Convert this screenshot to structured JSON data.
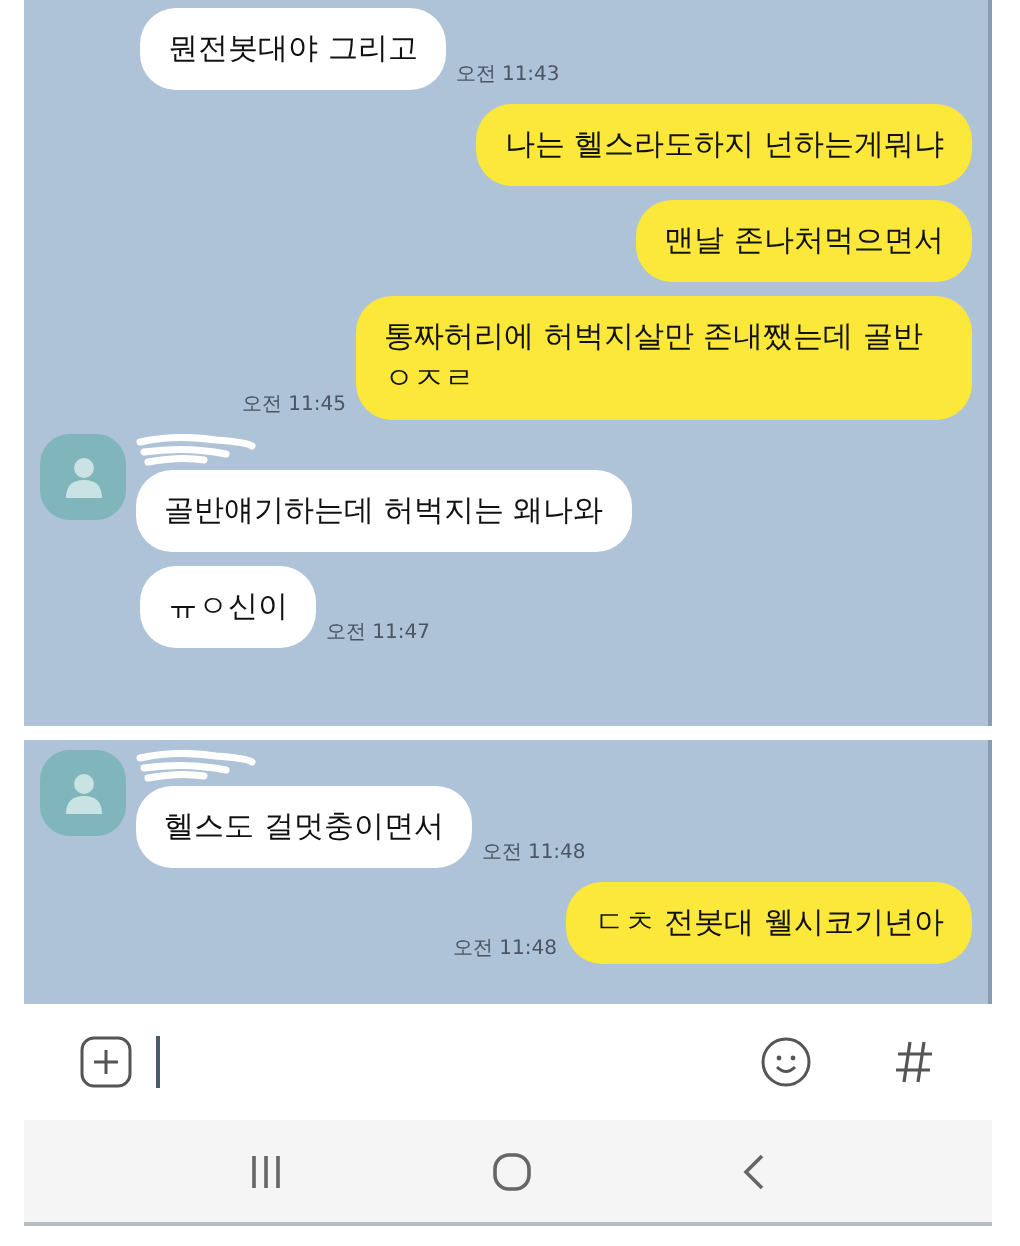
{
  "panels": [
    {
      "messages": [
        {
          "kind": "incoming",
          "avatar": false,
          "text": "뭔전봇대야 그리고",
          "time": "오전 11:43"
        },
        {
          "kind": "outgoing",
          "text": "나는 헬스라도하지 넌하는게뭐냐"
        },
        {
          "kind": "outgoing",
          "text": "맨날 존나처먹으면서"
        },
        {
          "kind": "outgoing",
          "text": "통짜허리에 허벅지살만 존내쨌는데 골반 ㅇㅈㄹ",
          "time": "오전 11:45"
        },
        {
          "kind": "incoming",
          "avatar": true,
          "text": "골반얘기하는데 허벅지는 왜나와"
        },
        {
          "kind": "incoming",
          "avatar": false,
          "text": "ㅠㅇ신이",
          "time": "오전 11:47"
        }
      ]
    },
    {
      "messages": [
        {
          "kind": "incoming",
          "avatar": true,
          "text": "헬스도 걸멋충이면서",
          "time": "오전 11:48"
        },
        {
          "kind": "outgoing",
          "text": "ㄷㅊ 전봇대 웰시코기년아",
          "time": "오전 11:48"
        }
      ]
    }
  ]
}
